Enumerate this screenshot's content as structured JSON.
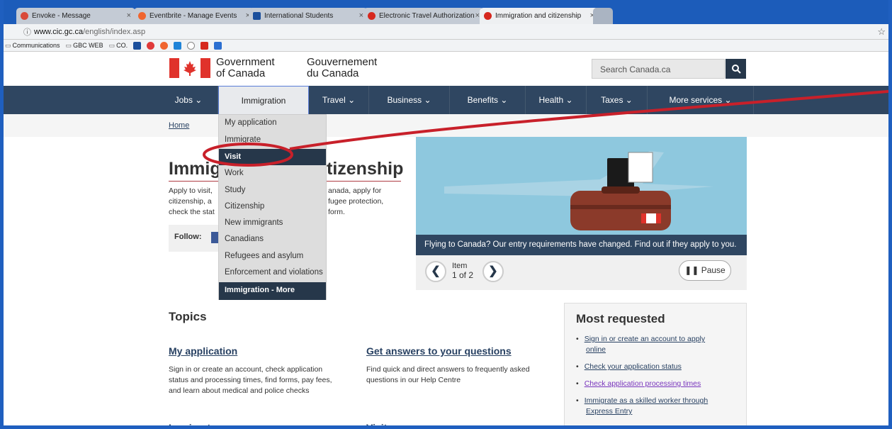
{
  "tabs": [
    {
      "label": "Envoke - Message",
      "color": "#d94a3a"
    },
    {
      "label": "Eventbrite - Manage Events",
      "color": "#f0652f"
    },
    {
      "label": "International Students",
      "color": "#1b4f9c"
    },
    {
      "label": "Electronic Travel Authorization",
      "color": "#d6281e"
    },
    {
      "label": "Immigration and citizenship",
      "color": "#d6281e"
    }
  ],
  "browser": {
    "url_host": "www.cic.gc.ca",
    "url_path": "/english/index.asp",
    "star": "☆"
  },
  "bookmarks": [
    {
      "label": "Communications",
      "icon": "folder-icon"
    },
    {
      "label": "GBC WEB",
      "icon": "folder-icon"
    },
    {
      "label": "CO.",
      "icon": "folder-icon"
    }
  ],
  "header": {
    "en_line1": "Government",
    "en_line2": "of Canada",
    "fr_line1": "Gouvernement",
    "fr_line2": "du Canada",
    "search_placeholder": "Search Canada.ca",
    "search_icon": "🔍"
  },
  "menu": [
    {
      "label": "Jobs ⌄"
    },
    {
      "label": "Immigration"
    },
    {
      "label": "Travel ⌄"
    },
    {
      "label": "Business ⌄"
    },
    {
      "label": "Benefits ⌄"
    },
    {
      "label": "Health ⌄"
    },
    {
      "label": "Taxes ⌄"
    },
    {
      "label": "More services ⌄"
    }
  ],
  "breadcrumb": "Home",
  "dropdown": [
    "My application",
    "Immigrate",
    "Visit",
    "Work",
    "Study",
    "Citizenship",
    "New immigrants",
    "Canadians",
    "Refugees and asylum",
    "Enforcement and violations",
    "Immigration - More"
  ],
  "main": {
    "title_part1": "Immig",
    "title_part2": "tizenship",
    "intro_l1a": "Apply to visit,",
    "intro_l1b": "anada, apply for",
    "intro_l2a": "citizenship, a",
    "intro_l2b": "fugee protection,",
    "intro_l3a": "check the stat",
    "intro_l3b": "form.",
    "follow": "Follow:"
  },
  "carousel": {
    "caption": "Flying to Canada? Our entry requirements have changed. Find out if they apply to you.",
    "item_l1": "Item",
    "item_l2": "1 of 2",
    "pause": "❚❚ Pause",
    "prev": "❮",
    "next": "❯"
  },
  "topics": {
    "heading": "Topics",
    "t1_title": "My application",
    "t1_l1": "Sign in or create an account, check application",
    "t1_l2": "status and processing times, find forms, pay fees,",
    "t1_l3": "and learn about medical and police checks",
    "t2_title": "Get answers to your questions",
    "t2_l1": "Find quick and direct answers to frequently asked",
    "t2_l2": "questions in our Help Centre",
    "t3_title": "Immigrate",
    "t4_title": "Visit"
  },
  "most_requested": {
    "heading": "Most requested",
    "items": [
      {
        "l1": "Sign in or create an account to apply",
        "l2": "online"
      },
      {
        "l1": "Check your application status",
        "l2": ""
      },
      {
        "l1": "Check application processing times",
        "l2": ""
      },
      {
        "l1": "Immigrate as a skilled worker through",
        "l2": "Express Entry"
      }
    ]
  },
  "colors": {
    "annotation": "#c8202a",
    "gc_nav": "#2f4661",
    "link": "#284162"
  }
}
